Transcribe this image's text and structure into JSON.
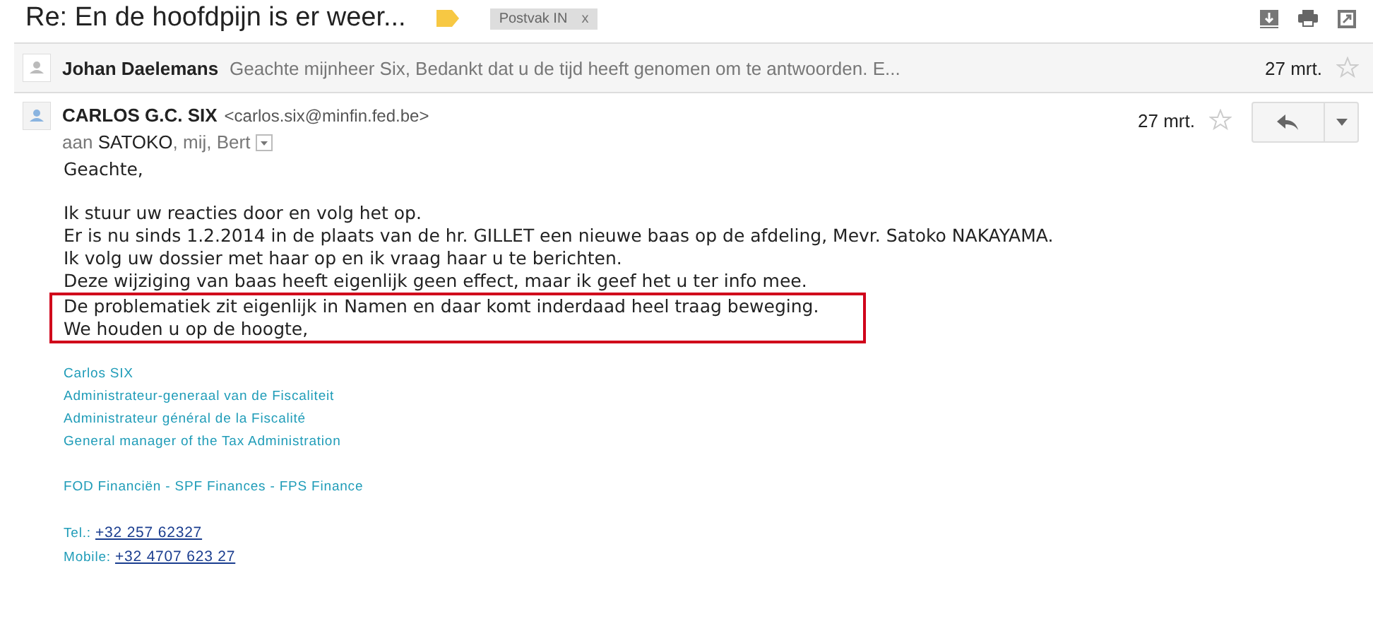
{
  "subject": "Re: En de hoofdpijn is er weer...",
  "label_tag": {
    "text": "Postvak IN",
    "remove": "x"
  },
  "collapsed_message": {
    "sender": "Johan Daelemans",
    "snippet": "Geachte mijnheer Six, Bedankt dat u de tijd heeft genomen om te antwoorden. E...",
    "date": "27 mrt.",
    "starred": false
  },
  "message": {
    "sender": "CARLOS G.C. SIX",
    "email": "<carlos.six@minfin.fed.be>",
    "to_prefix": "aan",
    "to_first": "SATOKO",
    "to_rest": ", mij, Bert",
    "date": "27 mrt.",
    "starred": false,
    "greeting": "Geachte,",
    "body": [
      {
        "text": "Ik stuur uw reacties door en volg het op.",
        "highlighted": false
      },
      {
        "text": "Er is nu sinds 1.2.2014 in de plaats van de hr. GILLET een nieuwe baas op de afdeling, Mevr. Satoko NAKAYAMA.",
        "highlighted": false
      },
      {
        "text": "Ik volg uw dossier met haar op en ik vraag haar u te berichten.",
        "highlighted": false
      },
      {
        "text": "Deze wijziging van baas heeft eigenlijk geen effect, maar ik geef het u ter info mee.",
        "highlighted": false
      },
      {
        "text": "De problematiek zit eigenlijk in Namen en daar komt inderdaad heel traag beweging.",
        "highlighted": true
      },
      {
        "text": "We houden u op de hoogte,",
        "highlighted": true
      }
    ],
    "signature": [
      [
        {
          "kind": "text",
          "text": "Carlos SIX"
        },
        {
          "kind": "text",
          "text": "Administrateur-generaal van de Fiscaliteit"
        },
        {
          "kind": "text",
          "text": "Administrateur général de la Fiscalité"
        },
        {
          "kind": "text",
          "text": "General manager of the Tax Administration"
        }
      ],
      [
        {
          "kind": "text",
          "text": "FOD Financiën - SPF Finances - FPS Finance"
        }
      ],
      [
        {
          "kind": "phone",
          "label": "Tel.:",
          "link": "+32 257 62327"
        },
        {
          "kind": "phone",
          "label": "Mobile:",
          "link": "+32 4707 623 27"
        }
      ]
    ]
  }
}
